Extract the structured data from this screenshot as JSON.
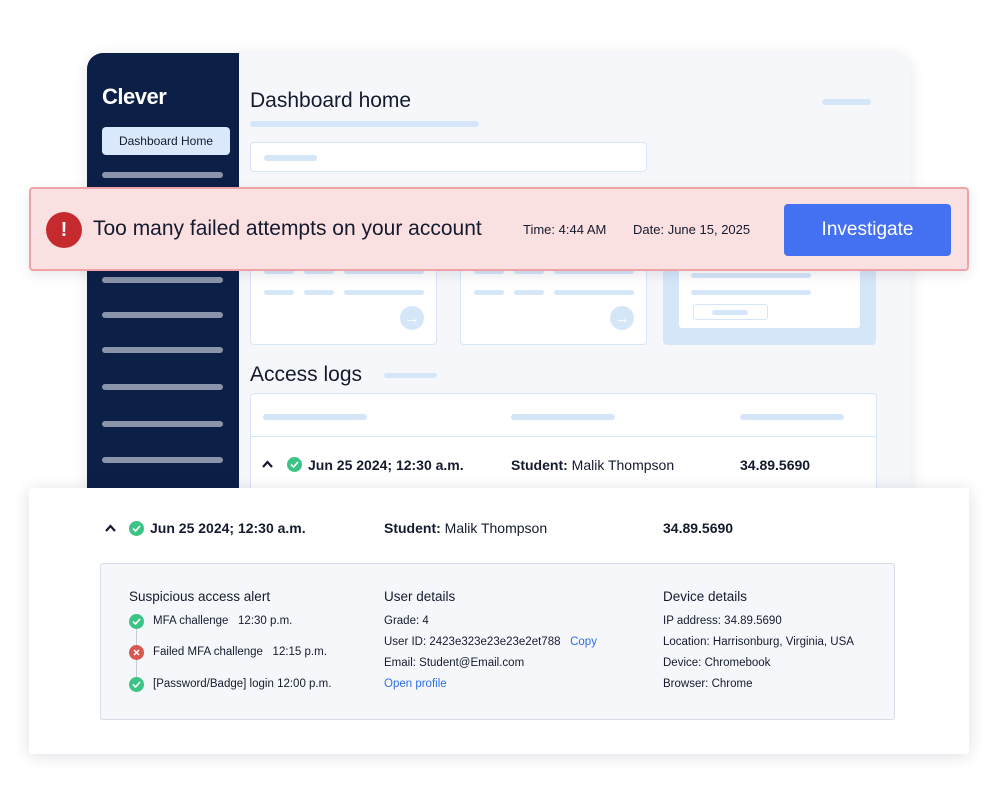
{
  "app": {
    "logo": "Clever",
    "nav_active": "Dashboard Home",
    "page_title": "Dashboard home",
    "section_title": "Access logs"
  },
  "logs_row": {
    "date": "Jun 25 2024; 12:30 a.m.",
    "student_label": "Student:",
    "student_name": "Malik Thompson",
    "ip": "34.89.5690"
  },
  "alert": {
    "icon": "exclamation-icon",
    "message": "Too many failed attempts on your account",
    "time_label": "Time:",
    "time_value": "4:44 AM",
    "date_label": "Date:",
    "date_value": "June 15, 2025",
    "button": "Investigate"
  },
  "detail": {
    "date": "Jun 25 2024; 12:30 a.m.",
    "student_label": "Student:",
    "student_name": "Malik Thompson",
    "ip": "34.89.5690",
    "suspicious": {
      "title": "Suspicious access alert",
      "events": [
        {
          "status": "success",
          "label": "MFA challenge",
          "time": "12:30 p.m."
        },
        {
          "status": "failed",
          "label": "Failed MFA challenge",
          "time": "12:15 p.m."
        },
        {
          "status": "success",
          "label": "[Password/Badge]",
          "suffix": "login",
          "time": "12:00 p.m."
        }
      ]
    },
    "user": {
      "title": "User details",
      "grade_label": "Grade:",
      "grade": "4",
      "id_label": "User ID:",
      "id": "2423e323e23e23e2et788",
      "copy": "Copy",
      "email_label": "Email:",
      "email": "Student@Email.com",
      "open_profile": "Open profile"
    },
    "device": {
      "title": "Device details",
      "ip_label": "IP address:",
      "ip": "34.89.5690",
      "location_label": "Location:",
      "location": "Harrisonburg, Virginia, USA",
      "device_label": "Device:",
      "device": "Chromebook",
      "browser_label": "Browser:",
      "browser": "Chrome"
    }
  },
  "colors": {
    "sidebar": "#0c1f47",
    "accent": "#4470f2",
    "alert_bg": "#fbe0e1",
    "alert_border": "#f0a3a6",
    "alert_icon": "#c52a2f",
    "success": "#3cc486",
    "failed": "#d9574f",
    "link": "#2f6fe4",
    "placeholder": "#d6e6f9"
  }
}
